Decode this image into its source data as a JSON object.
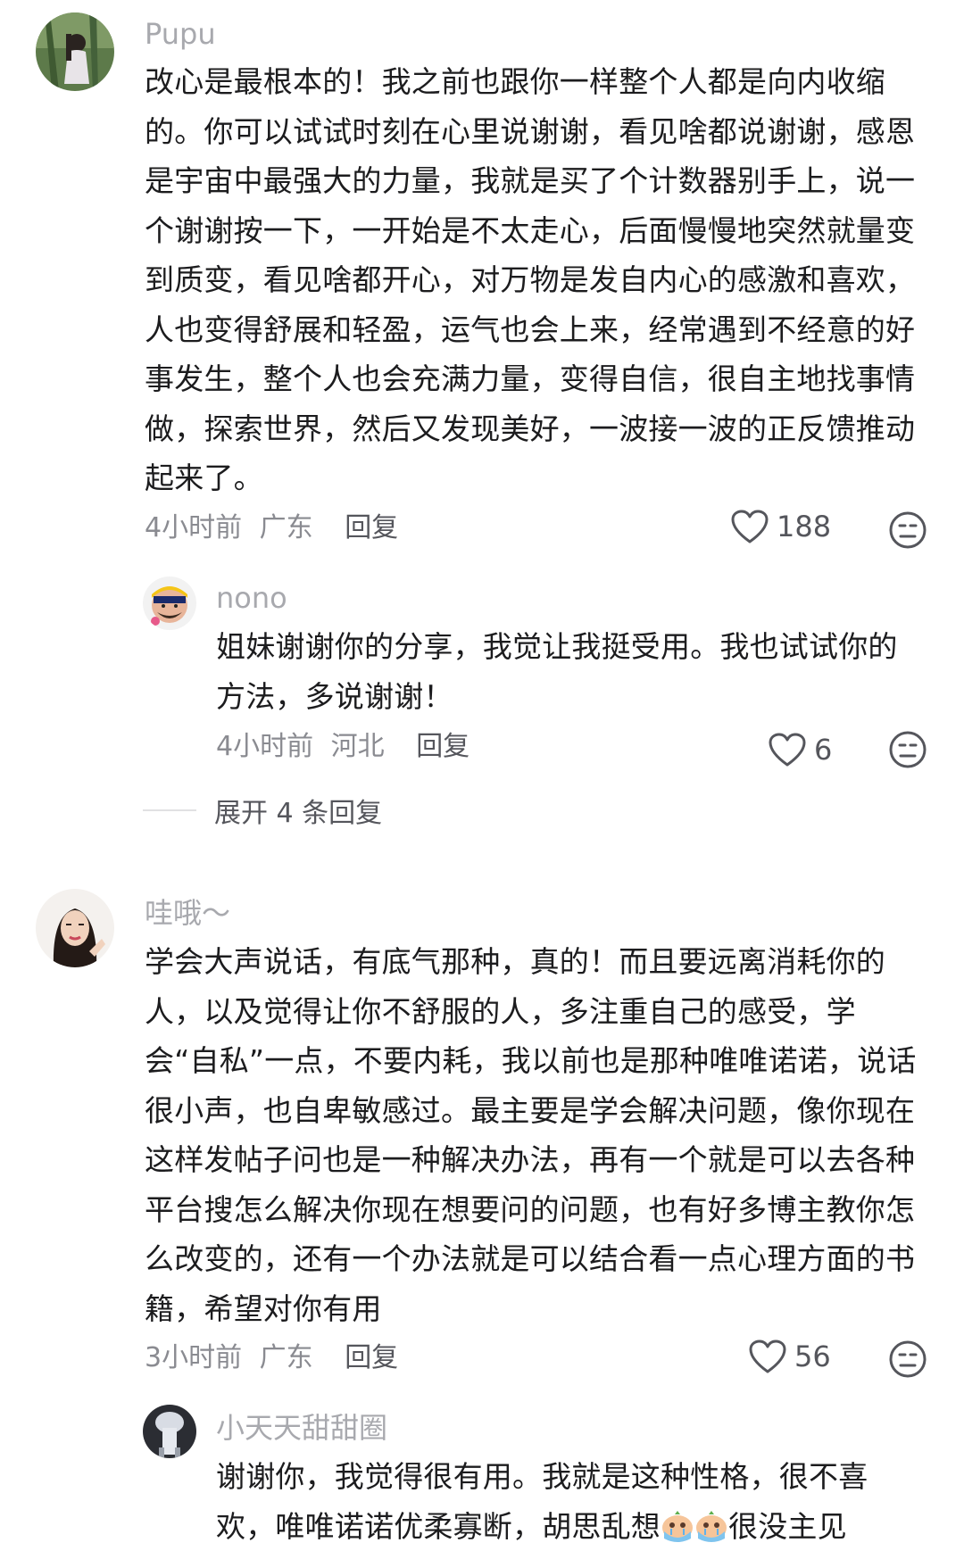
{
  "comments": [
    {
      "username": "Pupu",
      "text": "改心是最根本的！我之前也跟你一样整个人都是向内收缩的。你可以试试时刻在心里说谢谢，看见啥都说谢谢，感恩是宇宙中最强大的力量，我就是买了个计数器别手上，说一个谢谢按一下，一开始是不太走心，后面慢慢地突然就量变到质变，看见啥都开心，对万物是发自内心的感激和喜欢，人也变得舒展和轻盈，运气也会上来，经常遇到不经意的好事发生，整个人也会充满力量，变得自信，很自主地找事情做，探索世界，然后又发现美好，一波接一波的正反馈推动起来了。",
      "time": "4小时前",
      "location": "广东",
      "reply_label": "回复",
      "likes": "188",
      "replies": [
        {
          "username": "nono",
          "text": "姐妹谢谢你的分享，我觉让我挺受用。我也试试你的方法，多说谢谢！",
          "time": "4小时前",
          "location": "河北",
          "reply_label": "回复",
          "likes": "6"
        }
      ],
      "expand_label": "展开 4 条回复"
    },
    {
      "username": "哇哦～",
      "text": "学会大声说话，有底气那种，真的！而且要远离消耗你的人，以及觉得让你不舒服的人，多注重自己的感受，学会“自私”一点，不要内耗，我以前也是那种唯唯诺诺，说话很小声，也自卑敏感过。最主要是学会解决问题，像你现在这样发帖子问也是一种解决办法，再有一个就是可以去各种平台搜怎么解决你现在想要问的问题，也有好多博主教你怎么改变的，还有一个办法就是可以结合看一点心理方面的书籍，希望对你有用",
      "time": "3小时前",
      "location": "广东",
      "reply_label": "回复",
      "likes": "56",
      "replies": [
        {
          "username": "小天天甜甜圈",
          "text_before": "谢谢你，我觉得很有用。我就是这种性格，很不喜欢，唯唯诺诺优柔寡断，胡思乱想",
          "text_after": "很没主见",
          "emojis": [
            "crying-emoji",
            "crying-emoji"
          ]
        }
      ]
    }
  ],
  "icons": {
    "like": "heart-outline-icon",
    "dislike": "meh-face-icon"
  },
  "colors": {
    "username": "#a8a9ae",
    "text": "#1c1c1e",
    "meta": "#8a8b91"
  }
}
